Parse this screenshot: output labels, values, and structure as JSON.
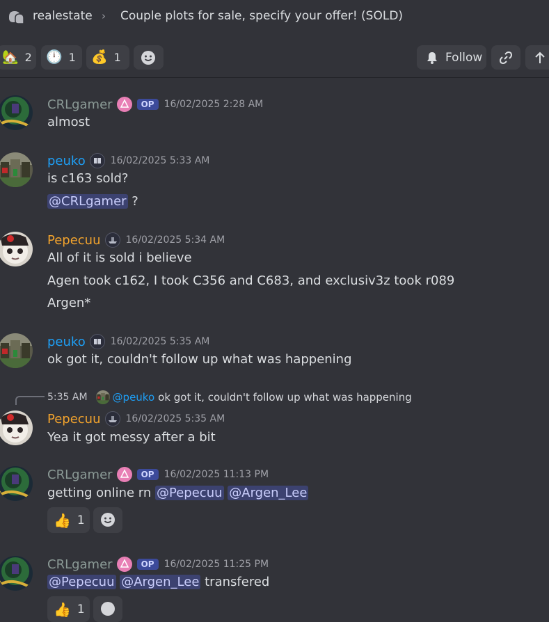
{
  "header": {
    "forum_name": "realestate",
    "thread_title": "Couple plots for sale, specify your offer! (SOLD)",
    "icon": "forum-thread-icon"
  },
  "toolbar": {
    "reactions": [
      {
        "emoji": "🏡",
        "count": "2"
      },
      {
        "emoji": "🕛",
        "count": "1"
      },
      {
        "emoji": "💰",
        "count": "1"
      }
    ],
    "follow_label": "Follow"
  },
  "messages": [
    {
      "user": "CRLgamer",
      "op": "OP",
      "time": "16/02/2025 2:28 AM",
      "lines": [
        "almost"
      ]
    },
    {
      "user": "peuko",
      "time": "16/02/2025 5:33 AM",
      "lines": [
        "is c163 sold?"
      ],
      "mention_line": {
        "mention": "@CRLgamer",
        "rest": " ?"
      }
    },
    {
      "user": "Pepecuu",
      "time": "16/02/2025 5:34 AM",
      "lines": [
        "All of it is sold i believe",
        "Agen took c162, I took C356 and C683, and exclusiv3z took r089",
        "Argen*"
      ]
    },
    {
      "user": "peuko",
      "time": "16/02/2025 5:35 AM",
      "lines": [
        "ok got it, couldn't follow up what was happening"
      ]
    },
    {
      "reply": {
        "time": "5:35 AM",
        "user": "@peuko",
        "text": "ok got it, couldn't follow up what was happening"
      },
      "user": "Pepecuu",
      "time": "16/02/2025 5:35 AM",
      "lines": [
        "Yea it got messy after a bit"
      ]
    },
    {
      "user": "CRLgamer",
      "op": "OP",
      "time": "16/02/2025 11:13 PM",
      "text": "getting online rn ",
      "mentions": [
        "@Pepecuu",
        "@Argen_Lee"
      ],
      "reaction": {
        "emoji": "👍",
        "count": "1"
      }
    },
    {
      "user": "CRLgamer",
      "op": "OP",
      "time": "16/02/2025 11:25 PM",
      "mentions": [
        "@Pepecuu",
        "@Argen_Lee"
      ],
      "text_after": " transfered",
      "reaction": {
        "emoji": "👍",
        "count": "1"
      }
    }
  ],
  "colors": {
    "background": "#323339",
    "mention_bg": "#3c4270",
    "op_badge": "#3c4a9a",
    "peuko": "#1e9ff5",
    "pepecuu": "#f2a32d",
    "crlgamer": "#8b9a96"
  }
}
